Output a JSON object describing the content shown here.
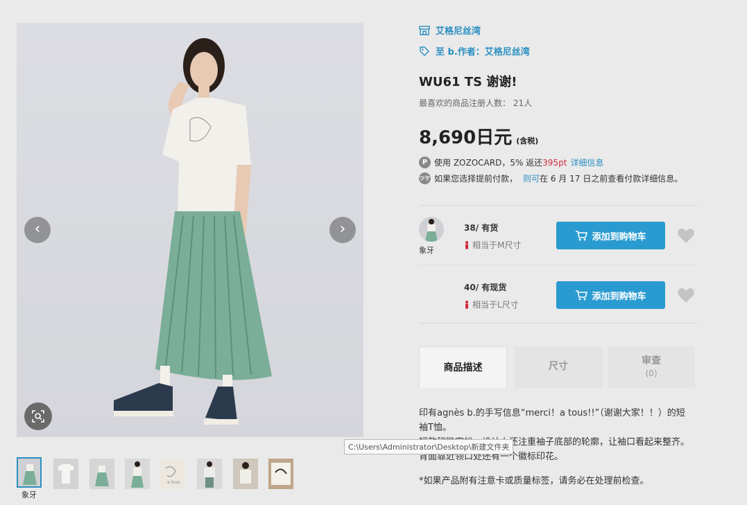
{
  "gallery": {
    "prev_icon": "‹",
    "next_icon": "›",
    "zoom_icon": "zoom-icon",
    "thumb_label": "象牙",
    "thumb_count": 8
  },
  "product": {
    "shop_name": "艾格尼丝湾",
    "brand_tag": "至 b.作者：艾格尼丝湾",
    "title": "WU61 TS 谢谢!",
    "fav_label": "最喜欢的商品注册人数：",
    "fav_value": "21人",
    "price": "8,690日元",
    "tax": "(含税)"
  },
  "benefits": {
    "zozocard_prefix": "使用 ZOZOCARD，5% 返还",
    "zozocard_points": "395pt",
    "zozocard_link": "详细信息",
    "deferred_prefix": "如果您选择提前付款，",
    "deferred_link": "则可",
    "deferred_suffix": "在 6 月 17 日之前查看付款详细信息。"
  },
  "skus": [
    {
      "color_label": "象牙",
      "size": "38/ 有货",
      "fit": "相当于M尺寸",
      "button": "添加到购物车"
    },
    {
      "size": "40/ 有现货",
      "fit": "相当于L尺寸",
      "button": "添加到购物车"
    }
  ],
  "tabs": {
    "description": "商品描述",
    "size": "尺寸",
    "review": "审查",
    "review_count": "(0)"
  },
  "description": {
    "line1": "印有agnès b.的手写信息“merci！a tous!!”（谢谢大家！！）的短袖T恤。",
    "line2": "短款稍微宽松，设计上还注重袖子底部的轮廓，让袖口看起来整齐。",
    "line3": "背面靠近领口处还有一个徽标印花。",
    "line4": "*如果产品附有注意卡或质量标签，请务必在处理前检查。"
  },
  "tooltip": "C:\\Users\\Administrator\\Desktop\\新建文件夹",
  "colors": {
    "accent": "#2a8fc1",
    "button": "#2a9bd0",
    "points": "#d0293b"
  }
}
